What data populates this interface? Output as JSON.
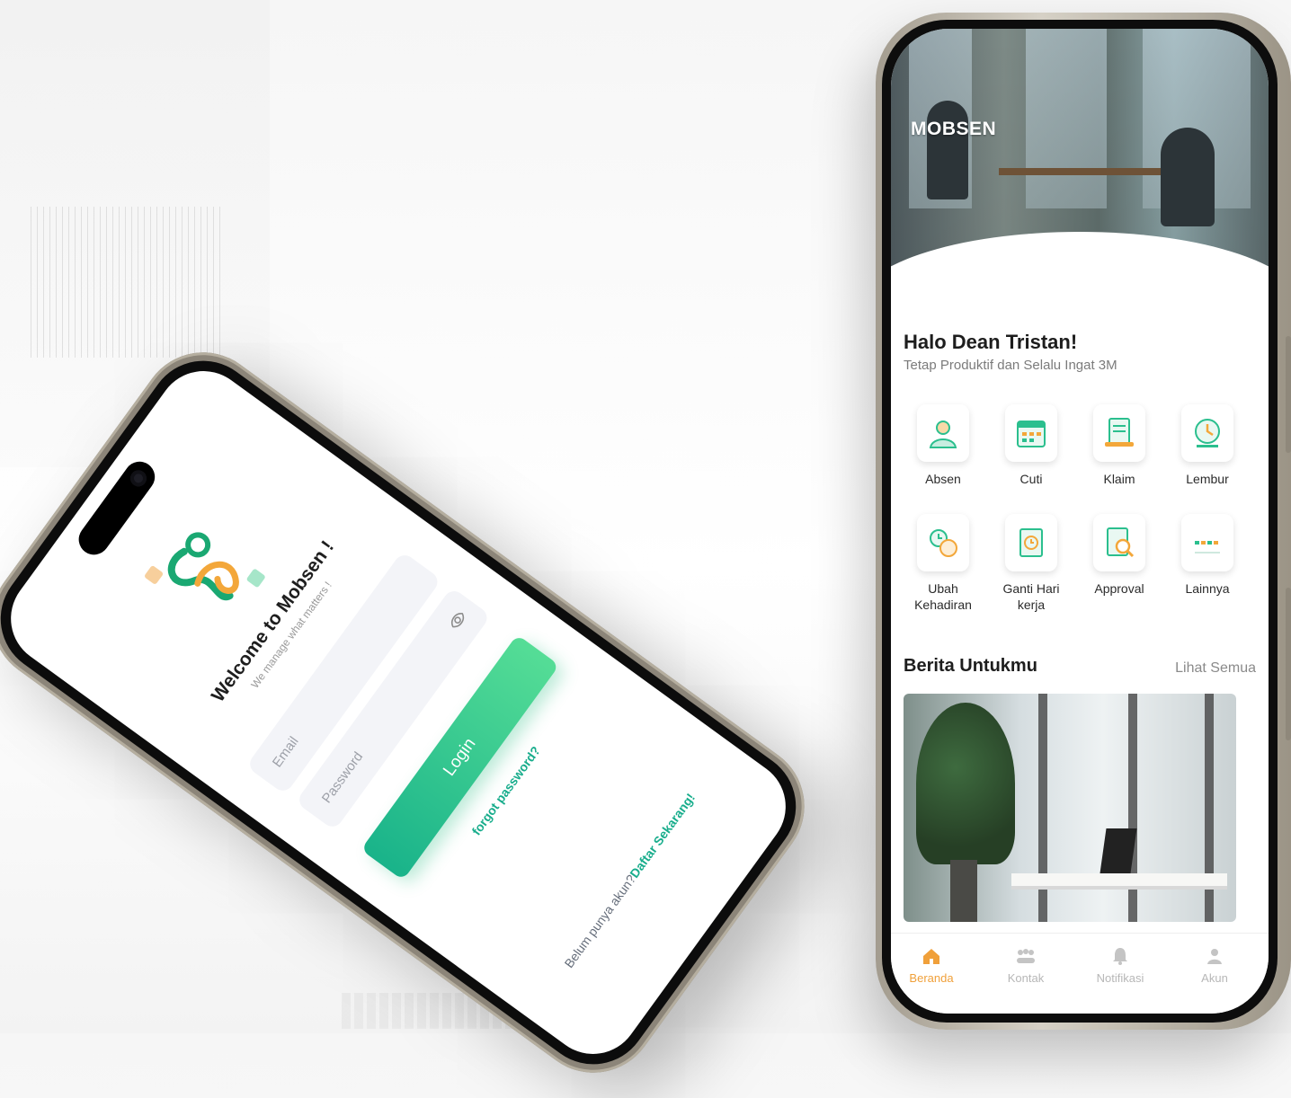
{
  "colors": {
    "accent_green": "#19b38a",
    "accent_orange": "#f0a03a",
    "text_dark": "#1d1d1d"
  },
  "login_screen": {
    "welcome": "Welcome to Mobsen !",
    "tagline": "We manage what matters !",
    "email_placeholder": "Email",
    "password_placeholder": "Password",
    "login_button": "Login",
    "forgot_password": "forgot password?",
    "register_prompt": "Belum punya akun?",
    "register_link": "Daftar Sekarang!"
  },
  "home_screen": {
    "brand": "MOBSEN",
    "greeting": "Halo Dean Tristan!",
    "subtitle": "Tetap Produktif dan Selalu Ingat 3M",
    "menu": [
      {
        "label": "Absen",
        "icon": "absen-icon"
      },
      {
        "label": "Cuti",
        "icon": "calendar-icon"
      },
      {
        "label": "Klaim",
        "icon": "claim-document-icon"
      },
      {
        "label": "Lembur",
        "icon": "overtime-clock-icon"
      },
      {
        "label": "Ubah Kehadiran",
        "icon": "attendance-change-icon"
      },
      {
        "label": "Ganti Hari kerja",
        "icon": "workday-swap-icon"
      },
      {
        "label": "Approval",
        "icon": "approval-search-icon"
      },
      {
        "label": "Lainnya",
        "icon": "more-icon"
      }
    ],
    "news_title": "Berita Untukmu",
    "see_all": "Lihat Semua",
    "nav": [
      {
        "label": "Beranda",
        "icon": "home-icon",
        "active": true
      },
      {
        "label": "Kontak",
        "icon": "contacts-icon",
        "active": false
      },
      {
        "label": "Notifikasi",
        "icon": "bell-icon",
        "active": false
      },
      {
        "label": "Akun",
        "icon": "user-icon",
        "active": false
      }
    ]
  }
}
